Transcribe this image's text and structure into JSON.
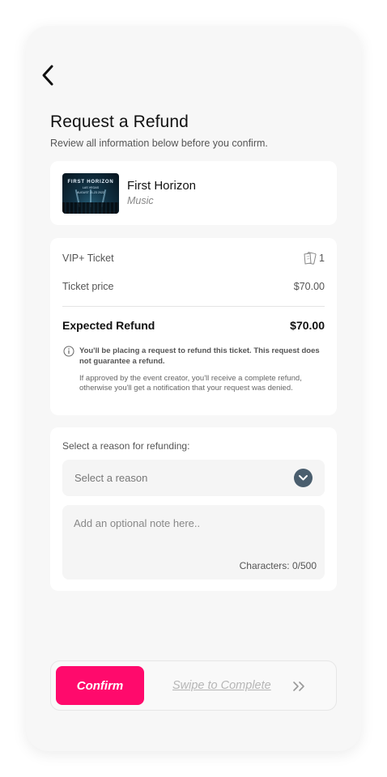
{
  "header": {
    "back_icon": "chevron-left-icon",
    "title": "Request a Refund",
    "subtitle": "Review all information below before you confirm."
  },
  "event": {
    "thumbnail": {
      "title": "FIRST HORIZON",
      "line1": "LAS VEGAS",
      "line2": "AUGUST 21-23 2022"
    },
    "name": "First Horizon",
    "category": "Music"
  },
  "ticket": {
    "type": "VIP+ Ticket",
    "ticket_icon": "ticket-icon",
    "quantity": "1",
    "price_label": "Ticket price",
    "price": "$70.00",
    "refund_label": "Expected Refund",
    "refund_amount": "$70.00",
    "info_icon": "info-icon",
    "info_bold": "You'll be placing a request to refund this ticket. This request does not guarantee a refund.",
    "info_text": "If approved by the event creator, you'll receive a complete refund, otherwise you'll get a notification that your request was denied."
  },
  "reason": {
    "label": "Select a reason for refunding:",
    "select_placeholder": "Select a reason",
    "select_icon": "chevron-down-icon",
    "note_placeholder": "Add an optional note here..",
    "char_count": "Characters: 0/500"
  },
  "footer": {
    "confirm_label": "Confirm",
    "swipe_label": "Swipe to Complete",
    "swipe_icon": "double-chevron-right-icon"
  },
  "colors": {
    "accent": "#ff0a6c",
    "chevron_badge": "#4a5e6e",
    "background": "#f7f7f7"
  }
}
